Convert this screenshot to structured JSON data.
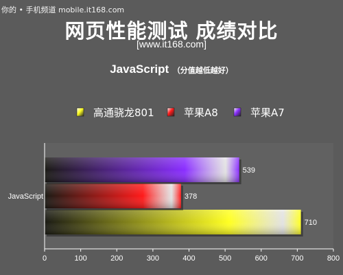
{
  "watermark": "你的 • 手机频道 mobile.it168.com",
  "title": "网页性能测试 成绩对比",
  "source": "[www.it168.com]",
  "subtitle": {
    "main": "JavaScript",
    "note": "（分值越低越好）"
  },
  "chart_data": {
    "type": "bar",
    "orientation": "horizontal",
    "categories": [
      "JavaScript"
    ],
    "series": [
      {
        "name": "高通骁龙801",
        "values": [
          710
        ],
        "color": "#ffff22"
      },
      {
        "name": "苹果A8",
        "values": [
          378
        ],
        "color": "#ff1a1a"
      },
      {
        "name": "苹果A7",
        "values": [
          539
        ],
        "color": "#8a2eff"
      }
    ],
    "xlim": [
      0,
      800
    ],
    "x_ticks": [
      0,
      100,
      200,
      300,
      400,
      500,
      600,
      700,
      800
    ],
    "grid": false,
    "legend_position": "top",
    "data_labels": true,
    "colors": {
      "background": "#5b5b5b",
      "plot_background": "#616161",
      "axis": "#ffffff",
      "text": "#ffffff"
    }
  }
}
